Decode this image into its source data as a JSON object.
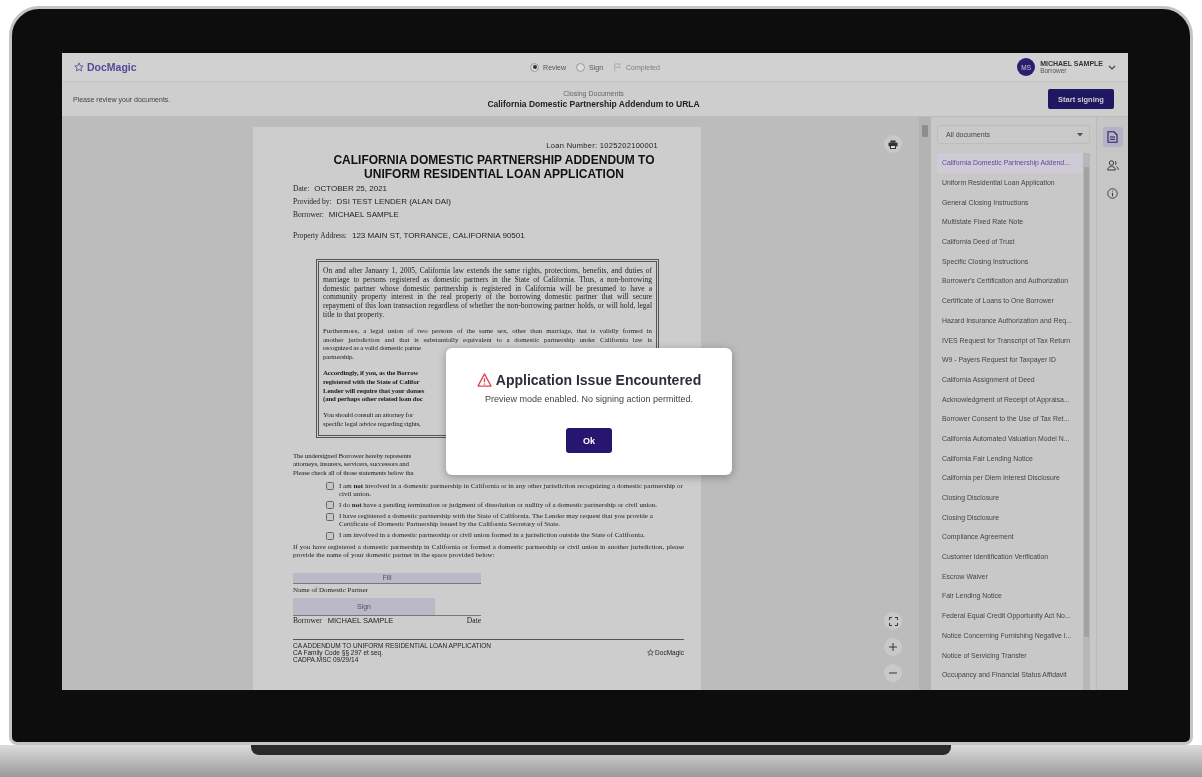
{
  "app": {
    "logo": "DocMagic",
    "steps": [
      {
        "label": "Review",
        "kind": "radio",
        "selected": true,
        "disabled": false
      },
      {
        "label": "Sign",
        "kind": "radio",
        "selected": false,
        "disabled": false
      },
      {
        "label": "Completed",
        "kind": "flag",
        "selected": false,
        "disabled": true
      }
    ],
    "user": {
      "initials": "MS",
      "name": "MICHAEL SAMPLE",
      "role": "Borrower"
    }
  },
  "subheader": {
    "hint": "Please review your documents.",
    "section": "Closing Documents",
    "title": "California Domestic Partnership Addendum to URLA",
    "button": "Start signing"
  },
  "document": {
    "loan_number": "Loan Number: 1025202100001",
    "title": "CALIFORNIA DOMESTIC PARTNERSHIP ADDENDUM TO UNIFORM RESIDENTIAL LOAN APPLICATION",
    "fields": [
      {
        "label": "Date:",
        "value": "OCTOBER 25, 2021"
      },
      {
        "label": "Provided by:",
        "value": "DSI TEST LENDER (ALAN DAI)"
      },
      {
        "label": "Borrower:",
        "value": "MICHAEL SAMPLE"
      },
      {
        "label": "Property Address:",
        "value": "123 MAIN ST, TORRANCE, CALIFORNIA 90501"
      }
    ],
    "notice": [
      {
        "kind": "paragraph",
        "text": "On and after January 1, 2005, California law extends the same rights, protections, benefits, and duties of marriage to persons registered as domestic partners in the State of California. Thus, a non-borrowing domestic partner whose domestic partnership is registered in California will be presumed to have a community property interest in the real property of the borrowing domestic partner that will secure repayment of this loan transaction regardless of whether the non-borrowing partner holds, or will hold, legal title to that property."
      },
      {
        "kind": "lines",
        "bold": false,
        "lines": [
          "Furthermore, a legal union of two persons of the same sex, other than marriage, that is validly formed in",
          "another jurisdiction and that is substantially equivalent to a domestic partnership under California law is",
          "recognized as a valid domestic partne",
          "partnership."
        ]
      },
      {
        "kind": "lines",
        "bold": true,
        "lines": [
          "Accordingly, if you, as the Borrow",
          "registered with the State of Califor",
          "Lender will require that your domes",
          "(and perhaps other related loan doc"
        ]
      },
      {
        "kind": "lines",
        "bold": false,
        "lines": [
          "You should consult an attorney for",
          "specific legal advice regarding rights,"
        ]
      }
    ],
    "statement_lines": [
      "The undersigned Borrower hereby represents",
      "attorneys, insurers, servicers, successors and",
      "Please check all of those statements below tha"
    ],
    "checks": [
      {
        "text": "I am **not** involved in a domestic partnership in California or in any other jurisdiction recognizing a domestic partnership or civil union.",
        "checked": false
      },
      {
        "text": "I do **not** have a pending termination or judgment of dissolution or nullity of a domestic partnership or civil union.",
        "checked": false
      },
      {
        "text": "I have registered a domestic partnership with the State of California. The Lender may request that you provide a Certificate of Domestic Partnership issued by the California Secretary of State.",
        "checked": false
      },
      {
        "text": "I am involved in a domestic partnership or civil union formed in a jurisdiction outside the State of California.",
        "checked": false
      }
    ],
    "instruction": "If you have registered a domestic partnership in California or formed a domestic partnership or civil union in another jurisdiction, please provide the name of your domestic partner in the space provided below:",
    "partner_field": {
      "placeholder": "Fill",
      "label": "Name of Domestic Partner"
    },
    "signature": {
      "button": "Sign",
      "label": "Borrower",
      "name": "MICHAEL SAMPLE",
      "date_label": "Date"
    },
    "footer": {
      "lines": [
        "CA ADDENDUM TO UNIFORM RESIDENTIAL LOAN APPLICATION",
        "CA Family Code §§ 297 et seq.",
        "CADPA.MSC  09/29/14"
      ],
      "logo": "DocMagic"
    }
  },
  "sidebar": {
    "filter": "All documents",
    "items": [
      {
        "label": "California Domestic Partnership Addend...",
        "selected": true
      },
      {
        "label": "Uniform Residential Loan Application",
        "selected": false
      },
      {
        "label": "General Closing Instructions",
        "selected": false
      },
      {
        "label": "Multistate Fixed Rate Note",
        "selected": false
      },
      {
        "label": "California Deed of Trust",
        "selected": false
      },
      {
        "label": "Specific Closing Instructions",
        "selected": false
      },
      {
        "label": "Borrower's Certification and Authorization",
        "selected": false
      },
      {
        "label": "Certificate of Loans to One Borrower",
        "selected": false
      },
      {
        "label": "Hazard Insurance Authorization and Req...",
        "selected": false
      },
      {
        "label": "IVES Request for Transcript of Tax Return",
        "selected": false
      },
      {
        "label": "W9 - Payers Request for Taxpayer ID",
        "selected": false
      },
      {
        "label": "California Assignment of Deed",
        "selected": false
      },
      {
        "label": "Acknowledgment of Receipt of Appraisa...",
        "selected": false
      },
      {
        "label": "Borrower Consent to the Use of Tax Ret...",
        "selected": false
      },
      {
        "label": "California Automated Valuation Model N...",
        "selected": false
      },
      {
        "label": "California Fair Lending Notice",
        "selected": false
      },
      {
        "label": "California per Diem Interest Disclosure",
        "selected": false
      },
      {
        "label": "Closing Disclosure",
        "selected": false
      },
      {
        "label": "Closing Disclosure",
        "selected": false
      },
      {
        "label": "Compliance Agreement",
        "selected": false
      },
      {
        "label": "Customer Identification Verification",
        "selected": false
      },
      {
        "label": "Escrow Waiver",
        "selected": false
      },
      {
        "label": "Fair Lending Notice",
        "selected": false
      },
      {
        "label": "Federal Equal Credit Opportunity Act No...",
        "selected": false
      },
      {
        "label": "Notice Concerning Furnishing Negative I...",
        "selected": false
      },
      {
        "label": "Notice of Servicing Transfer",
        "selected": false
      },
      {
        "label": "Occupancy and Financial Status Affidavit",
        "selected": false
      }
    ]
  },
  "rail": [
    {
      "kind": "document",
      "selected": true
    },
    {
      "kind": "people",
      "selected": false
    },
    {
      "kind": "info",
      "selected": false
    }
  ],
  "dialog": {
    "title": "Application Issue Encountered",
    "message": "Preview mode enabled. No signing action permitted.",
    "button": "Ok"
  }
}
